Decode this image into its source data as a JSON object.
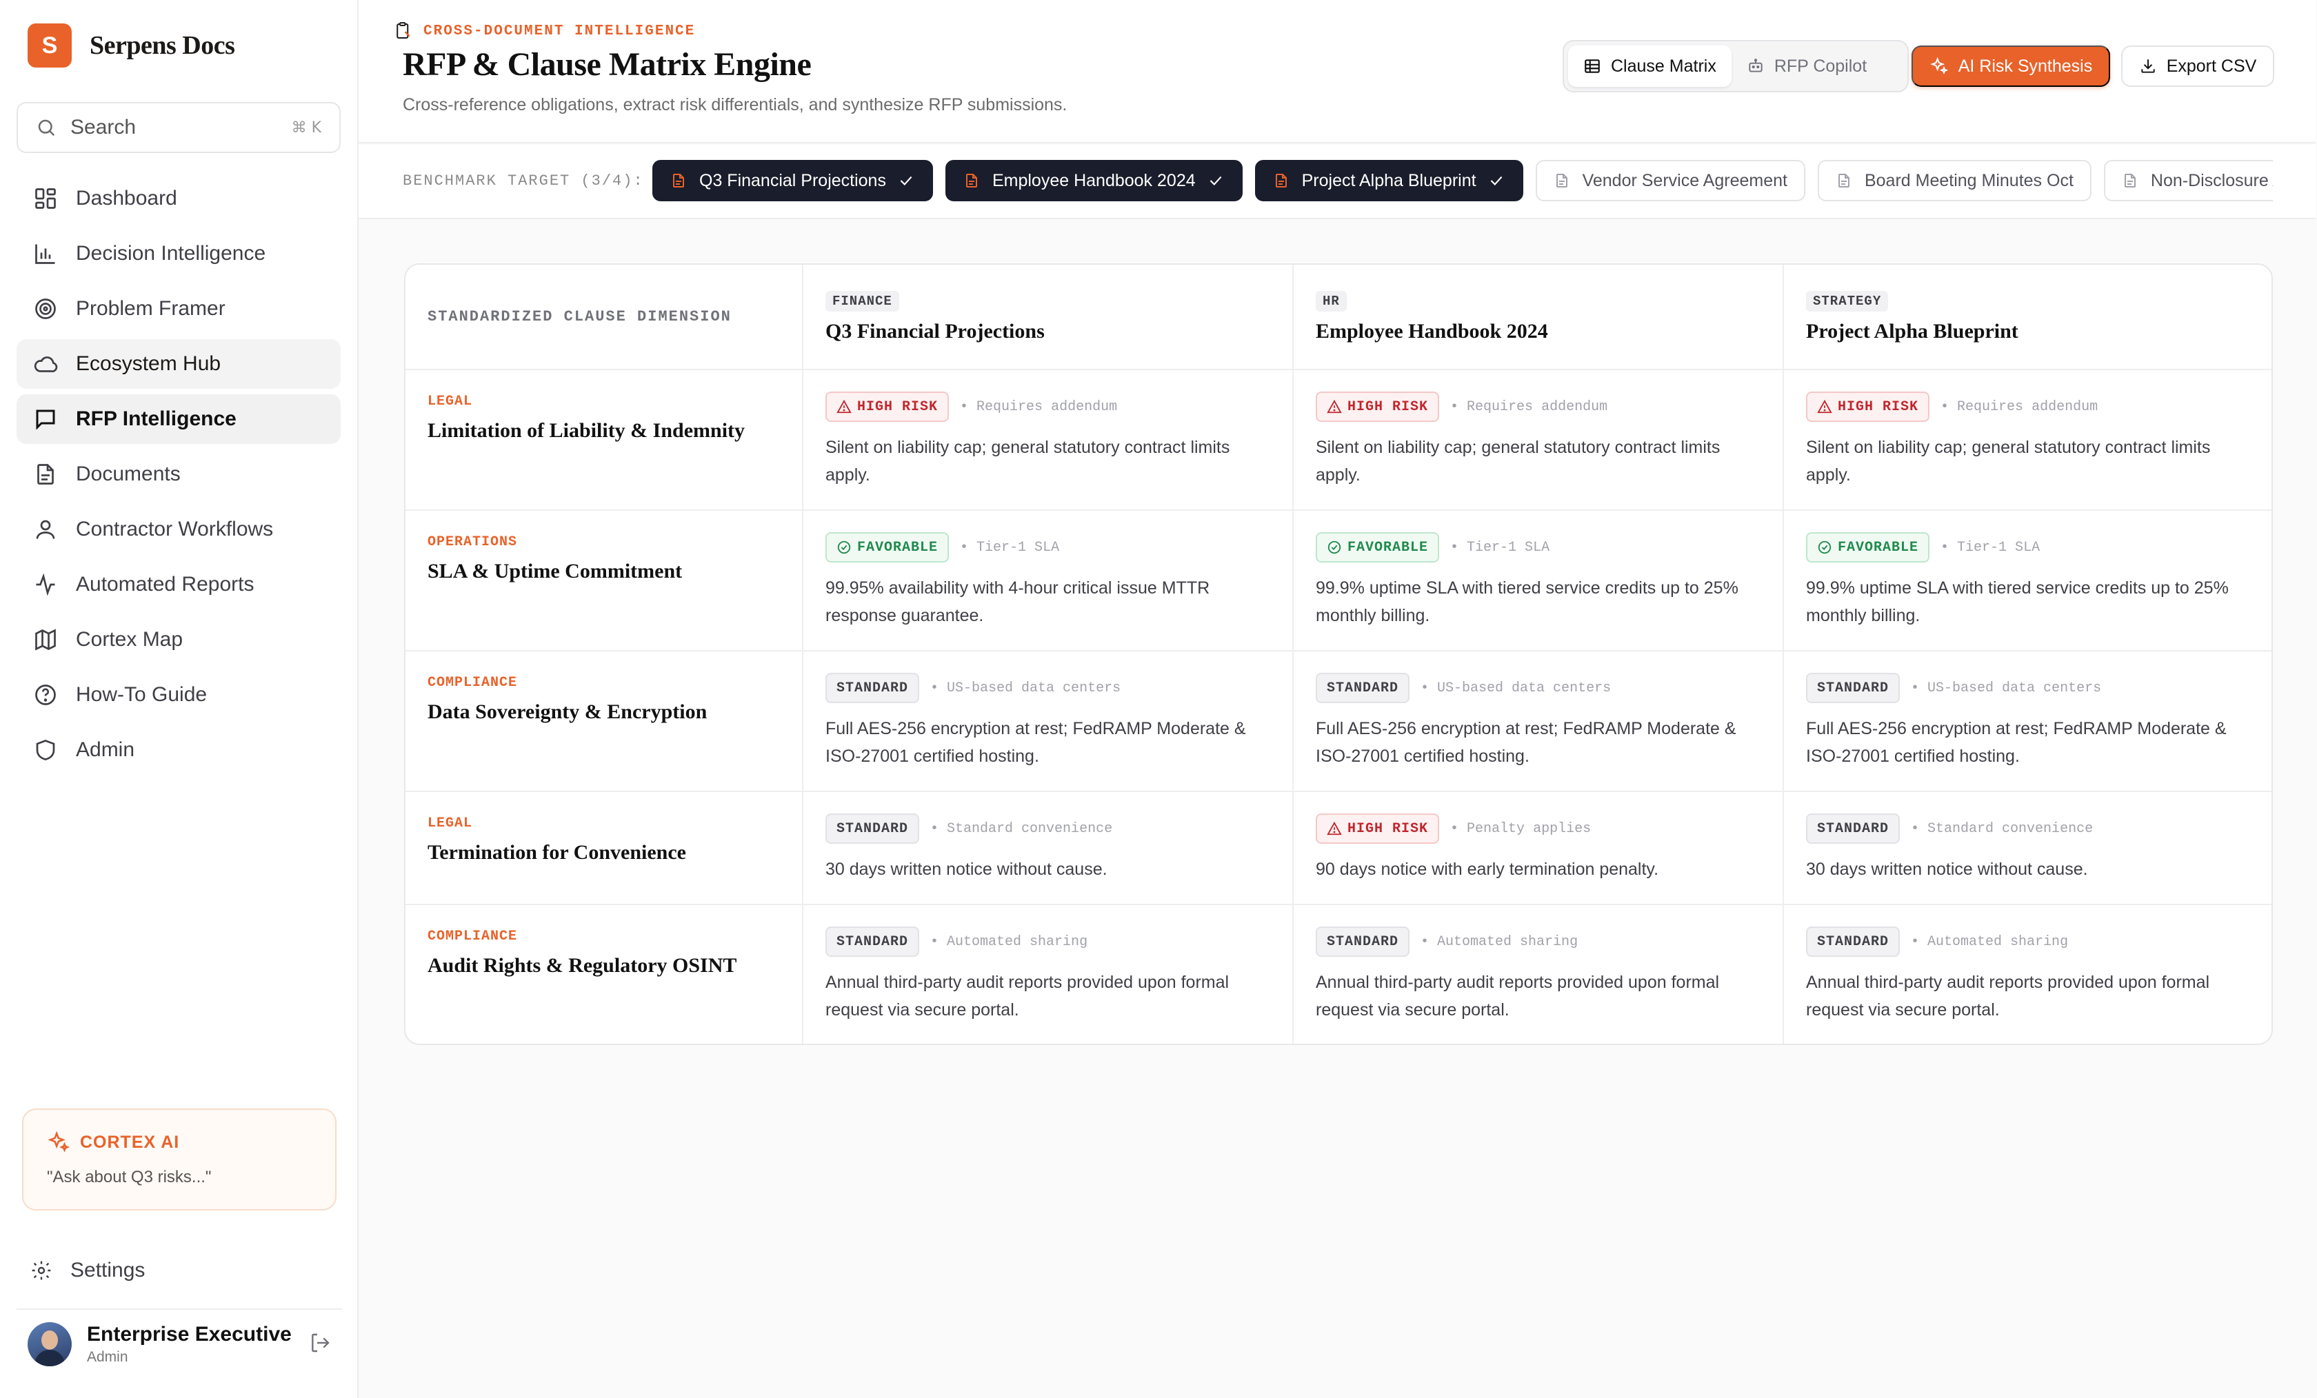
{
  "brand": {
    "logo_letter": "S",
    "name": "Serpens Docs"
  },
  "search": {
    "placeholder": "Search",
    "shortcut": "⌘ K"
  },
  "nav": [
    {
      "label": "Dashboard",
      "icon": "dashboard-grid-icon"
    },
    {
      "label": "Decision Intelligence",
      "icon": "bar-chart-icon"
    },
    {
      "label": "Problem Framer",
      "icon": "target-icon"
    },
    {
      "label": "Ecosystem Hub",
      "icon": "cloud-icon",
      "state": "hover"
    },
    {
      "label": "RFP Intelligence",
      "icon": "message-square-icon",
      "state": "active"
    },
    {
      "label": "Documents",
      "icon": "file-text-icon"
    },
    {
      "label": "Contractor Workflows",
      "icon": "user-icon"
    },
    {
      "label": "Automated Reports",
      "icon": "activity-icon"
    },
    {
      "label": "Cortex Map",
      "icon": "map-icon"
    },
    {
      "label": "How-To Guide",
      "icon": "help-circle-icon"
    },
    {
      "label": "Admin",
      "icon": "shield-icon"
    }
  ],
  "cortex": {
    "title": "CORTEX AI",
    "prompt": "\"Ask about Q3 risks...\""
  },
  "settings_label": "Settings",
  "user": {
    "name": "Enterprise Executive",
    "role": "Admin"
  },
  "header": {
    "eyebrow": "CROSS-DOCUMENT INTELLIGENCE",
    "title": "RFP & Clause Matrix Engine",
    "subtitle": "Cross-reference obligations, extract risk differentials, and synthesize RFP submissions.",
    "view_toggle": [
      {
        "label": "Clause Matrix",
        "active": true
      },
      {
        "label": "RFP Copilot",
        "active": false
      }
    ],
    "ai_button": "AI Risk Synthesis",
    "export_button": "Export CSV"
  },
  "benchmark": {
    "label": "BENCHMARK TARGET (3/4):",
    "chips": [
      {
        "label": "Q3 Financial Projections",
        "selected": true
      },
      {
        "label": "Employee Handbook 2024",
        "selected": true
      },
      {
        "label": "Project Alpha Blueprint",
        "selected": true
      },
      {
        "label": "Vendor Service Agreement",
        "selected": false
      },
      {
        "label": "Board Meeting Minutes Oct",
        "selected": false
      },
      {
        "label": "Non-Disclosure Agreement",
        "selected": false
      }
    ]
  },
  "matrix": {
    "dimension_header": "STANDARDIZED CLAUSE DIMENSION",
    "columns": [
      {
        "tag": "FINANCE",
        "title": "Q3 Financial Projections"
      },
      {
        "tag": "HR",
        "title": "Employee Handbook 2024"
      },
      {
        "tag": "STRATEGY",
        "title": "Project Alpha Blueprint"
      }
    ],
    "rows": [
      {
        "category": "LEGAL",
        "name": "Limitation of Liability & Indemnity",
        "cells": [
          {
            "badge": "HIGH RISK",
            "kind": "high",
            "note": "Requires addendum",
            "text": "Silent on liability cap; general statutory contract limits apply."
          },
          {
            "badge": "HIGH RISK",
            "kind": "high",
            "note": "Requires addendum",
            "text": "Silent on liability cap; general statutory contract limits apply."
          },
          {
            "badge": "HIGH RISK",
            "kind": "high",
            "note": "Requires addendum",
            "text": "Silent on liability cap; general statutory contract limits apply."
          }
        ]
      },
      {
        "category": "OPERATIONS",
        "name": "SLA & Uptime Commitment",
        "cells": [
          {
            "badge": "FAVORABLE",
            "kind": "fav",
            "note": "Tier-1 SLA",
            "text": "99.95% availability with 4-hour critical issue MTTR response guarantee."
          },
          {
            "badge": "FAVORABLE",
            "kind": "fav",
            "note": "Tier-1 SLA",
            "text": "99.9% uptime SLA with tiered service credits up to 25% monthly billing."
          },
          {
            "badge": "FAVORABLE",
            "kind": "fav",
            "note": "Tier-1 SLA",
            "text": "99.9% uptime SLA with tiered service credits up to 25% monthly billing."
          }
        ]
      },
      {
        "category": "COMPLIANCE",
        "name": "Data Sovereignty & Encryption",
        "cells": [
          {
            "badge": "STANDARD",
            "kind": "std",
            "note": "US-based data centers",
            "text": "Full AES-256 encryption at rest; FedRAMP Moderate & ISO-27001 certified hosting."
          },
          {
            "badge": "STANDARD",
            "kind": "std",
            "note": "US-based data centers",
            "text": "Full AES-256 encryption at rest; FedRAMP Moderate & ISO-27001 certified hosting."
          },
          {
            "badge": "STANDARD",
            "kind": "std",
            "note": "US-based data centers",
            "text": "Full AES-256 encryption at rest; FedRAMP Moderate & ISO-27001 certified hosting."
          }
        ]
      },
      {
        "category": "LEGAL",
        "name": "Termination for Convenience",
        "cells": [
          {
            "badge": "STANDARD",
            "kind": "std",
            "note": "Standard convenience",
            "text": "30 days written notice without cause."
          },
          {
            "badge": "HIGH RISK",
            "kind": "high",
            "note": "Penalty applies",
            "text": "90 days notice with early termination penalty."
          },
          {
            "badge": "STANDARD",
            "kind": "std",
            "note": "Standard convenience",
            "text": "30 days written notice without cause."
          }
        ]
      },
      {
        "category": "COMPLIANCE",
        "name": "Audit Rights & Regulatory OSINT",
        "cells": [
          {
            "badge": "STANDARD",
            "kind": "std",
            "note": "Automated sharing",
            "text": "Annual third-party audit reports provided upon formal request via secure portal."
          },
          {
            "badge": "STANDARD",
            "kind": "std",
            "note": "Automated sharing",
            "text": "Annual third-party audit reports provided upon formal request via secure portal."
          },
          {
            "badge": "STANDARD",
            "kind": "std",
            "note": "Automated sharing",
            "text": "Annual third-party audit reports provided upon formal request via secure portal."
          }
        ]
      }
    ]
  },
  "colors": {
    "accent": "#e8622a",
    "dark_chip": "#1a1d2b",
    "high_risk": "#c0262d",
    "favorable": "#1f8a4c"
  }
}
